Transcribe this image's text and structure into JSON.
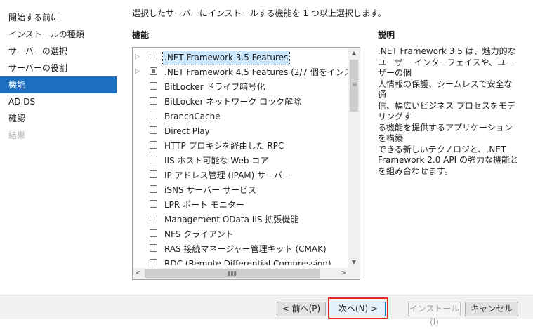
{
  "nav": {
    "items": [
      {
        "label": "開始する前に",
        "state": "normal"
      },
      {
        "label": "インストールの種類",
        "state": "normal"
      },
      {
        "label": "サーバーの選択",
        "state": "normal"
      },
      {
        "label": "サーバーの役割",
        "state": "normal"
      },
      {
        "label": "機能",
        "state": "active"
      },
      {
        "label": "AD DS",
        "state": "normal"
      },
      {
        "label": "確認",
        "state": "normal"
      },
      {
        "label": "結果",
        "state": "disabled"
      }
    ]
  },
  "main": {
    "instruction": "選択したサーバーにインストールする機能を 1 つ以上選択します。",
    "features_header": "機能",
    "description_header": "説明",
    "features": [
      {
        "label": ".NET Framework 3.5 Features",
        "expandable": true,
        "check": "unchecked",
        "selected": true
      },
      {
        "label": ".NET Framework 4.5 Features (2/7 個をインスト",
        "expandable": true,
        "check": "partial",
        "selected": false
      },
      {
        "label": "BitLocker ドライブ暗号化",
        "expandable": false,
        "check": "unchecked",
        "selected": false
      },
      {
        "label": "BitLocker ネットワーク ロック解除",
        "expandable": false,
        "check": "unchecked",
        "selected": false
      },
      {
        "label": "BranchCache",
        "expandable": false,
        "check": "unchecked",
        "selected": false
      },
      {
        "label": "Direct Play",
        "expandable": false,
        "check": "unchecked",
        "selected": false
      },
      {
        "label": "HTTP プロキシを経由した RPC",
        "expandable": false,
        "check": "unchecked",
        "selected": false
      },
      {
        "label": "IIS ホスト可能な Web コア",
        "expandable": false,
        "check": "unchecked",
        "selected": false
      },
      {
        "label": "IP アドレス管理 (IPAM) サーバー",
        "expandable": false,
        "check": "unchecked",
        "selected": false
      },
      {
        "label": "iSNS サーバー サービス",
        "expandable": false,
        "check": "unchecked",
        "selected": false
      },
      {
        "label": "LPR ポート モニター",
        "expandable": false,
        "check": "unchecked",
        "selected": false
      },
      {
        "label": "Management OData IIS 拡張機能",
        "expandable": false,
        "check": "unchecked",
        "selected": false
      },
      {
        "label": "NFS クライアント",
        "expandable": false,
        "check": "unchecked",
        "selected": false
      },
      {
        "label": "RAS 接続マネージャー管理キット (CMAK)",
        "expandable": false,
        "check": "unchecked",
        "selected": false
      },
      {
        "label": "RDC (Remote Differential Compression)",
        "expandable": false,
        "check": "unchecked",
        "selected": false
      }
    ],
    "description": ".NET Framework 3.5 は、魅力的な\nユーザー インターフェイスや、ユーザーの個\n人情報の保護、シームレスで安全な通\n信、幅広いビジネス プロセスをモデリングす\nる機能を提供するアプリケーションを構築\nできる新しいテクノロジと、.NET\nFramework 2.0 API の強力な機能と\nを組み合わせます。"
  },
  "icons": {
    "expander": "expand-triangle-icon",
    "scroll_up": "scroll-up-arrow-icon",
    "scroll_down": "scroll-down-arrow-icon",
    "scroll_left": "scroll-left-arrow-icon",
    "scroll_right": "scroll-right-arrow-icon"
  },
  "footer": {
    "prev_label": "< 前へ(P)",
    "next_label": "次へ(N) >",
    "install_label": "インストール(I)",
    "cancel_label": "キャンセル"
  },
  "colors": {
    "nav_active": "#1c6fbf",
    "selection": "#cce8ff",
    "highlight_border": "#e5282a"
  }
}
